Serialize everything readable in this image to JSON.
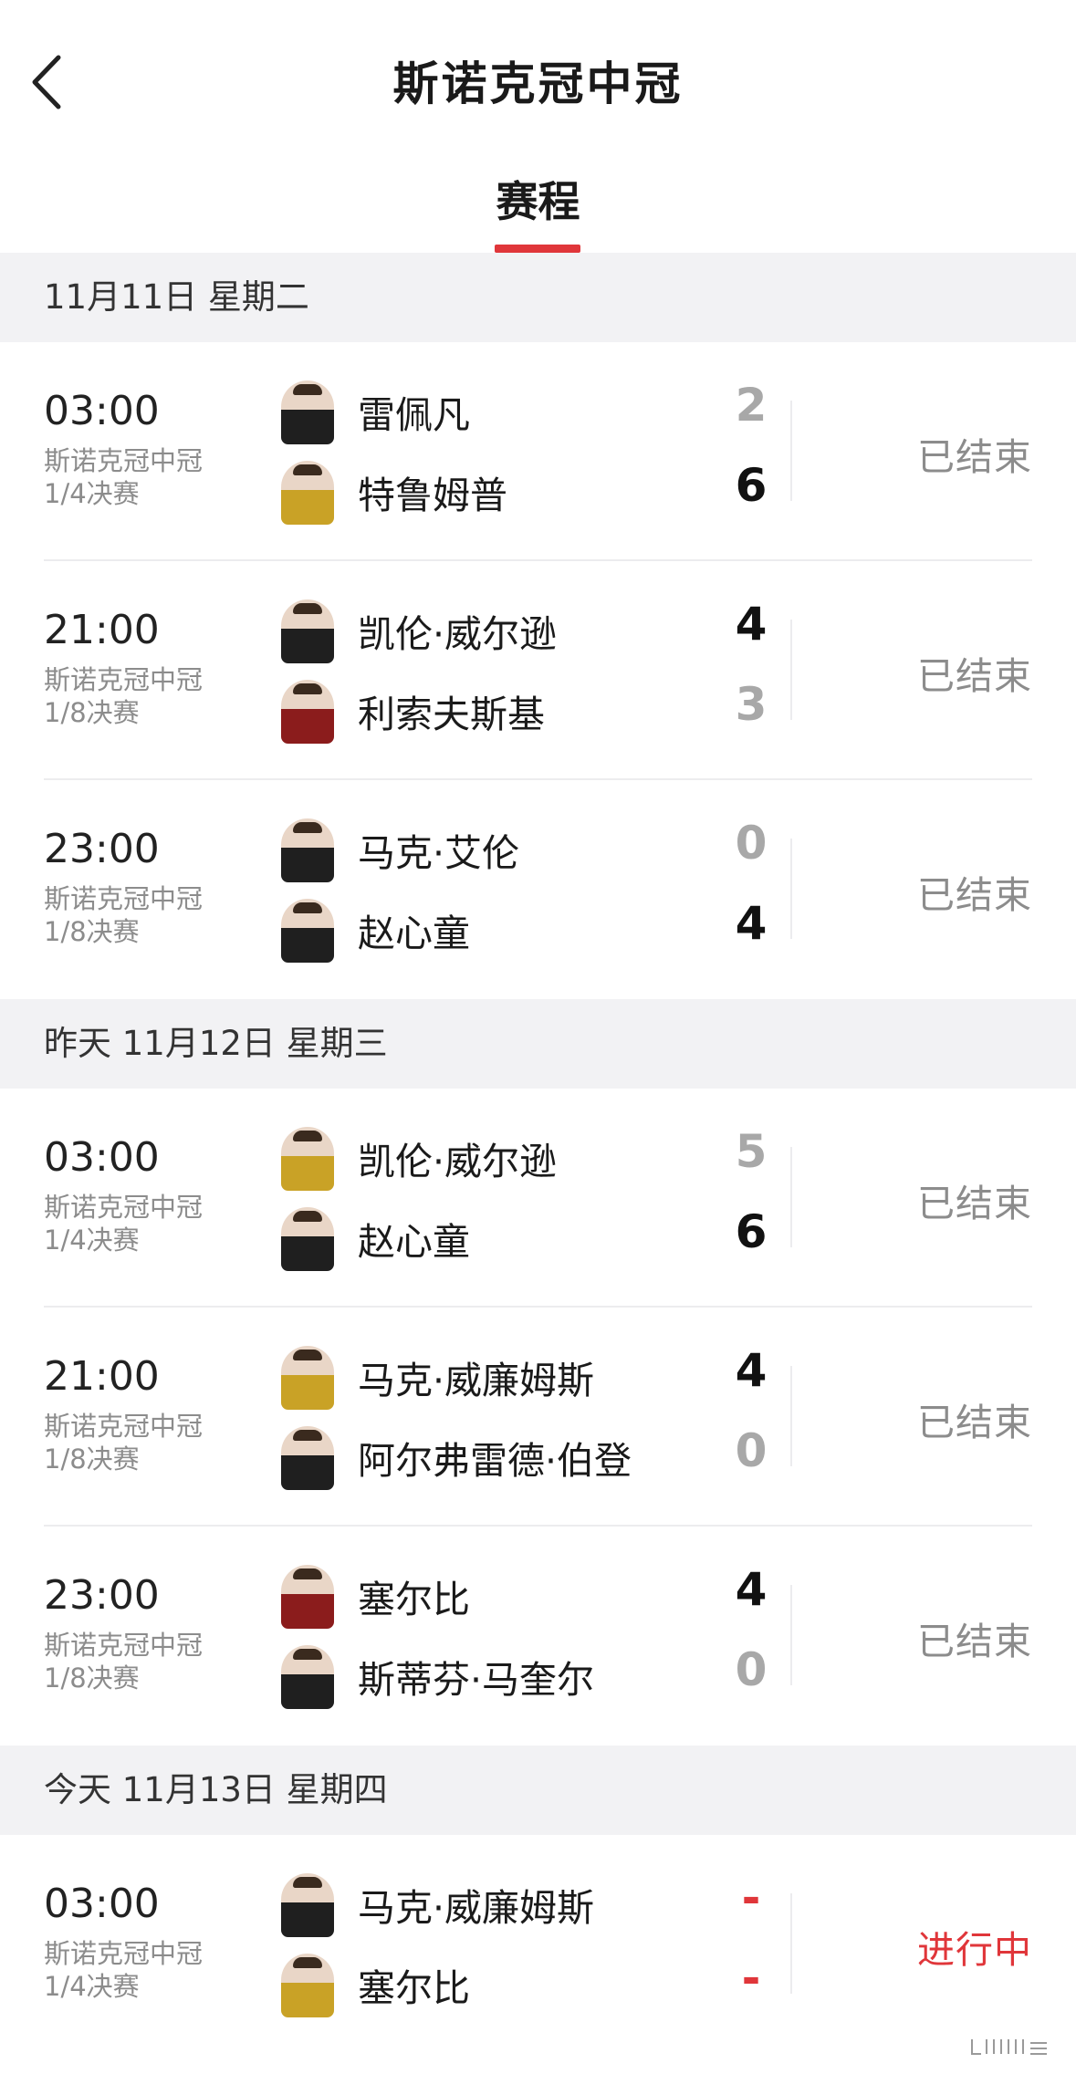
{
  "header": {
    "title": "斯诺克冠中冠",
    "tab": "赛程"
  },
  "dates": [
    {
      "label": "11月11日 星期二",
      "matches": [
        {
          "time": "03:00",
          "event": "斯诺克冠中冠",
          "round": "1/4决赛",
          "p1": "雷佩凡",
          "s1": "2",
          "r1": "lose",
          "p2": "特鲁姆普",
          "s2": "6",
          "r2": "win",
          "status": "已结束",
          "live": false
        },
        {
          "time": "21:00",
          "event": "斯诺克冠中冠",
          "round": "1/8决赛",
          "p1": "凯伦·威尔逊",
          "s1": "4",
          "r1": "win",
          "p2": "利索夫斯基",
          "s2": "3",
          "r2": "lose",
          "status": "已结束",
          "live": false
        },
        {
          "time": "23:00",
          "event": "斯诺克冠中冠",
          "round": "1/8决赛",
          "p1": "马克·艾伦",
          "s1": "0",
          "r1": "lose",
          "p2": "赵心童",
          "s2": "4",
          "r2": "win",
          "status": "已结束",
          "live": false
        }
      ]
    },
    {
      "label": "昨天  11月12日  星期三",
      "matches": [
        {
          "time": "03:00",
          "event": "斯诺克冠中冠",
          "round": "1/4决赛",
          "p1": "凯伦·威尔逊",
          "s1": "5",
          "r1": "lose",
          "p2": "赵心童",
          "s2": "6",
          "r2": "win",
          "status": "已结束",
          "live": false
        },
        {
          "time": "21:00",
          "event": "斯诺克冠中冠",
          "round": "1/8决赛",
          "p1": "马克·威廉姆斯",
          "s1": "4",
          "r1": "win",
          "p2": "阿尔弗雷德·伯登",
          "s2": "0",
          "r2": "lose",
          "status": "已结束",
          "live": false
        },
        {
          "time": "23:00",
          "event": "斯诺克冠中冠",
          "round": "1/8决赛",
          "p1": "塞尔比",
          "s1": "4",
          "r1": "win",
          "p2": "斯蒂芬·马奎尔",
          "s2": "0",
          "r2": "lose",
          "status": "已结束",
          "live": false
        }
      ]
    },
    {
      "label": "今天  11月13日  星期四",
      "matches": [
        {
          "time": "03:00",
          "event": "斯诺克冠中冠",
          "round": "1/4决赛",
          "p1": "马克·威廉姆斯",
          "s1": "-",
          "r1": "live",
          "p2": "塞尔比",
          "s2": "-",
          "r2": "live",
          "status": "进行中",
          "live": true
        }
      ]
    }
  ],
  "colors": {
    "accent": "#e0363a",
    "muted": "#8c8c8c",
    "section_bg": "#f2f2f4"
  }
}
